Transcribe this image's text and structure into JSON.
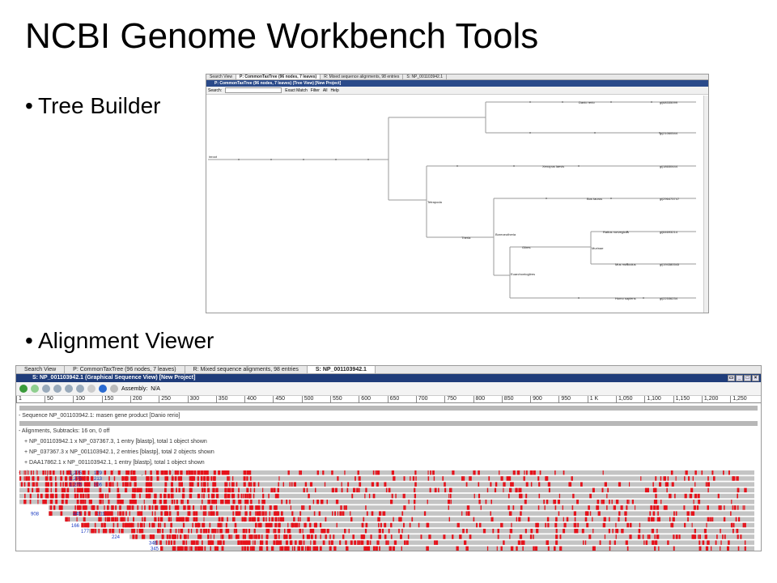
{
  "slide": {
    "title": "NCBI Genome Workbench Tools",
    "bullet1": "Tree Builder",
    "bullet2": "Alignment Viewer"
  },
  "tree_window": {
    "tabs": [
      "Search View",
      "P: CommonTaxTree (96 nodes, 7 leaves)",
      "R: Mixed sequence alignments, 98 entries",
      "S: NP_001103942.1"
    ],
    "title": "P: CommonTaxTree (96 nodes, 7 leaves) (Tree View) [New Project]",
    "search_label": "Search:",
    "match_label": "Exact Match",
    "filter_label": "Filter",
    "all_label": "All",
    "help_label": "Help",
    "root_label": "inroot",
    "node_labels": {
      "danio": "Danio rerio",
      "xenopus": "Xenopus laevis",
      "tetrapoda": "Tetrapoda",
      "theria": "Theria",
      "boreoeutheria": "Boreoeutheria",
      "bos": "Bos taurus",
      "rattus": "Rattus norvegicus",
      "murinae": "Murinae",
      "mus": "Mus musculus",
      "euarchontoglires": "Euarchontoglires",
      "homo": "Homo sapiens",
      "glires": "Glires"
    },
    "leaf_ids": [
      "gi|68335099",
      "gi|18650444",
      "gi|21060544",
      "gi|296475747",
      "gi|64693214",
      "gi|194380545",
      "gi|22536234"
    ]
  },
  "aln_window": {
    "tabs": [
      "Search View",
      "P: CommonTaxTree (96 nodes, 7 leaves)",
      "R: Mixed sequence alignments, 98 entries",
      "S: NP_001103942.1"
    ],
    "title": "S: NP_001103942.1 (Graphical Sequence View) [New Project]",
    "assembly_label": "Assembly:",
    "assembly_value": "N/A",
    "ruler": [
      "1",
      "50",
      "100",
      "150",
      "200",
      "250",
      "300",
      "350",
      "400",
      "450",
      "500",
      "550",
      "600",
      "650",
      "700",
      "750",
      "800",
      "850",
      "900",
      "950",
      "1 K",
      "1,050",
      "1,100",
      "1,150",
      "1,200",
      "1,250"
    ],
    "tracks": [
      "- Sequence NP_001103942.1: masen gene product [Danio rerio]",
      "- Alignments, Subtracks: 16 on, 0 off",
      "+ NP_001103942.1 x NP_037367.3, 1 entry [blastp], total 1 object shown",
      "+ NP_037367.3 x NP_001103942.1, 2 entries [blastp], total 2 objects shown",
      "+ DAA17862.1 x NP_001103942.1, 1 entry [blastp], total 1 object shown",
      "- Mixed sequence alignments, 49 entries: RefSeq, total 16 objects shown"
    ],
    "row_labels": [
      "1,275",
      "179",
      "1,275",
      "213",
      "1,275",
      "206",
      "908",
      "445",
      "211",
      "166",
      "177",
      "224",
      "346",
      "345"
    ]
  },
  "colors": {
    "accent": "#e5121b",
    "titlebar": "#1f3c7a"
  }
}
